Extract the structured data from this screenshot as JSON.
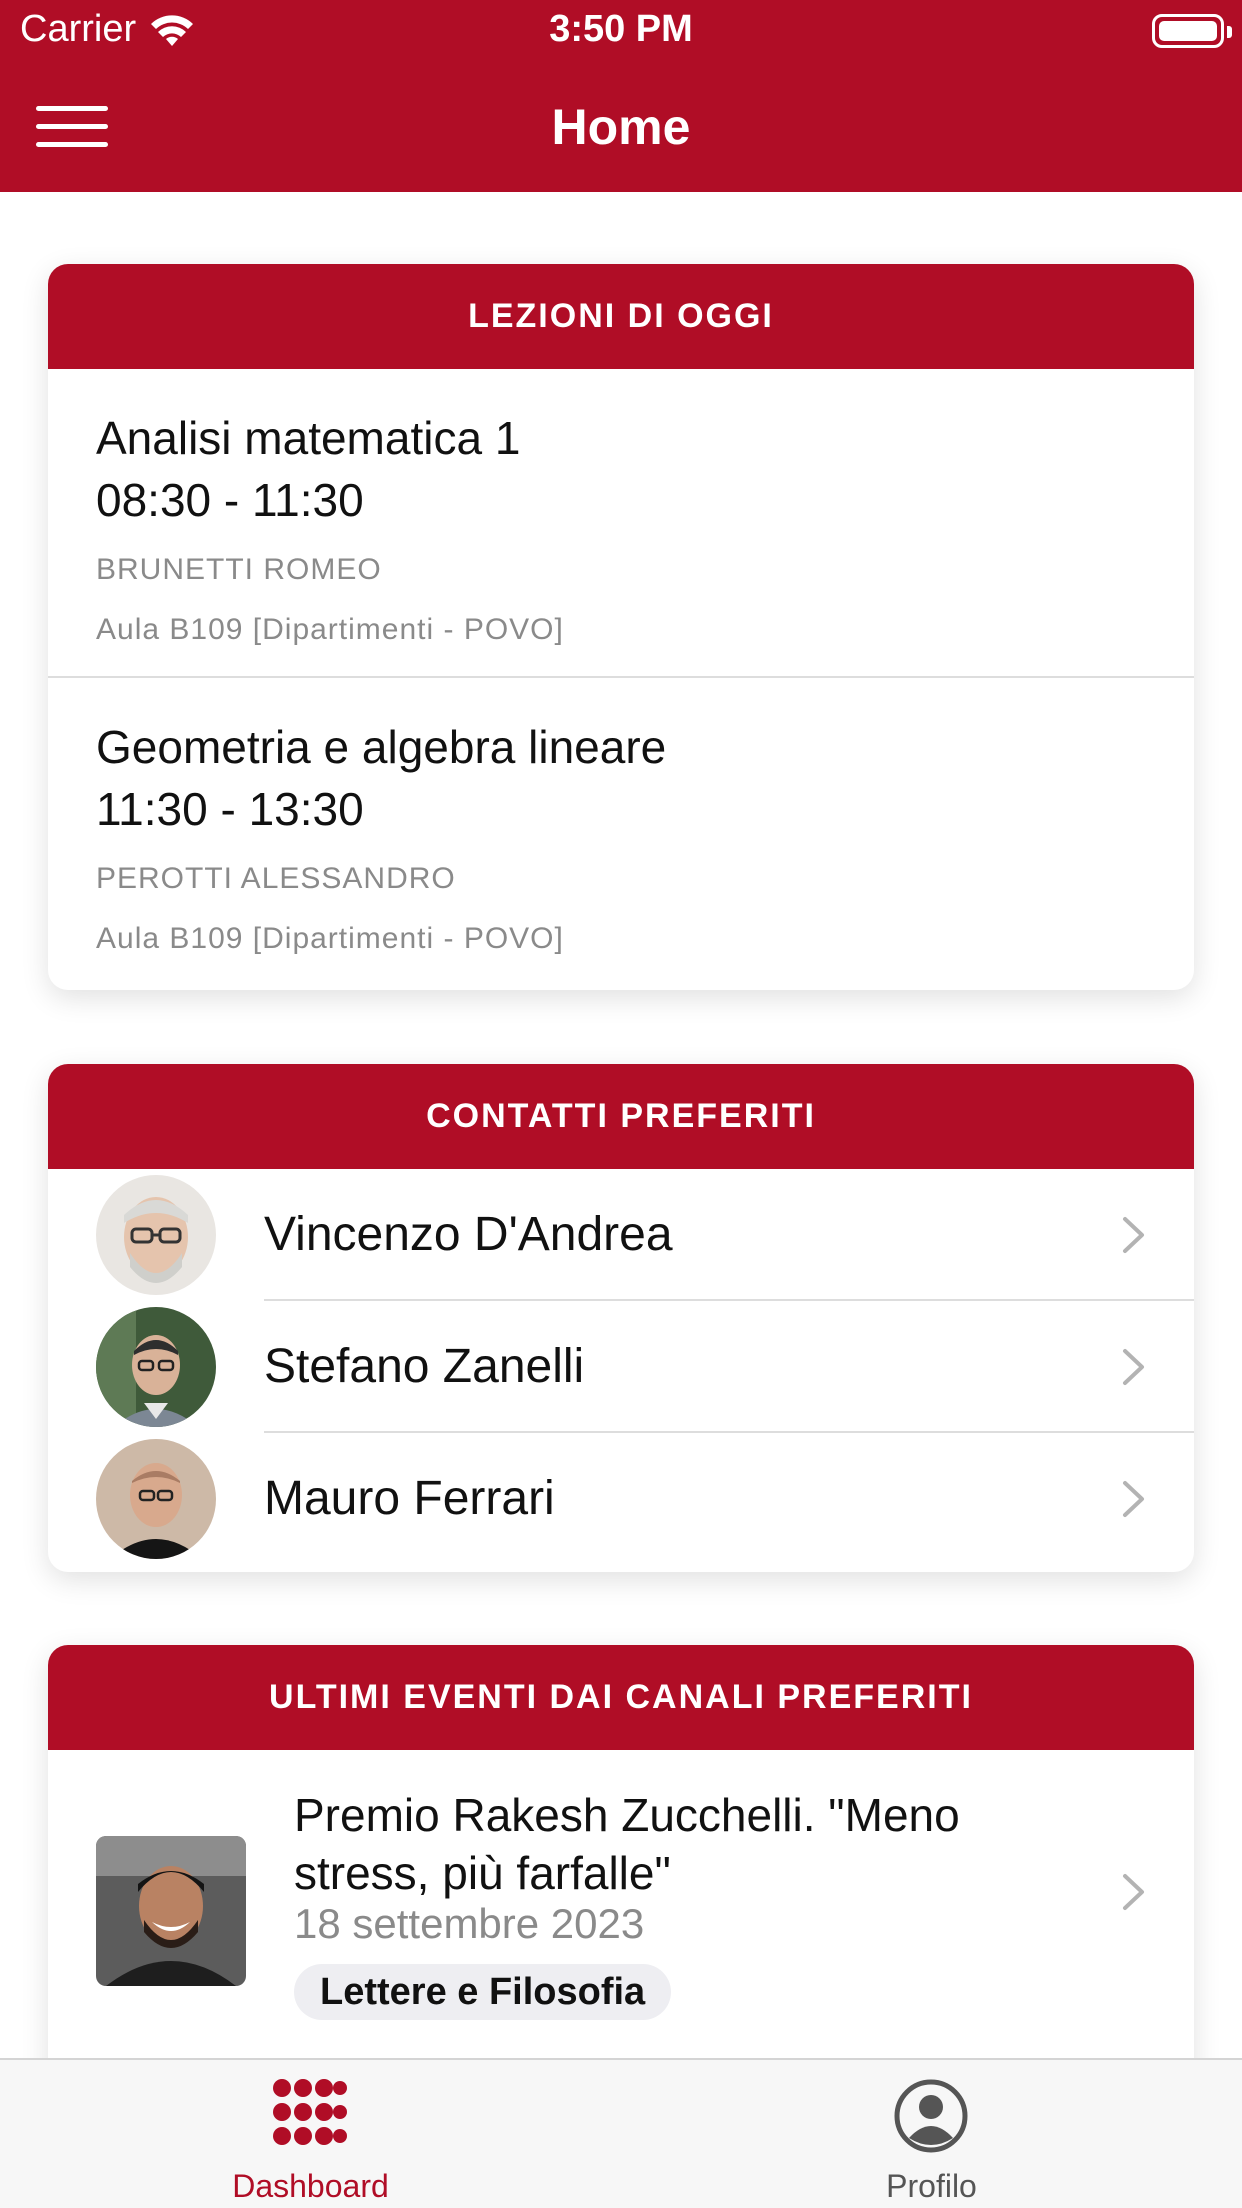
{
  "status_bar": {
    "carrier": "Carrier",
    "time": "3:50 PM"
  },
  "nav": {
    "title": "Home",
    "menu_icon": "hamburger-menu-icon"
  },
  "colors": {
    "brand": "#b00d26",
    "secondary_text": "#8a8a8a",
    "tab_inactive": "#555555"
  },
  "lessons_card": {
    "header": "LEZIONI DI OGGI",
    "items": [
      {
        "name": "Analisi matematica 1",
        "time": "08:30 - 11:30",
        "teacher": "BRUNETTI ROMEO",
        "room": "Aula B109 [Dipartimenti - POVO]"
      },
      {
        "name": "Geometria e algebra lineare",
        "time": "11:30 - 13:30",
        "teacher": "PEROTTI ALESSANDRO",
        "room": "Aula B109 [Dipartimenti - POVO]"
      }
    ]
  },
  "contacts_card": {
    "header": "CONTATTI PREFERITI",
    "items": [
      {
        "name": "Vincenzo D'Andrea",
        "icon": "chevron-right-icon"
      },
      {
        "name": "Stefano Zanelli",
        "icon": "chevron-right-icon"
      },
      {
        "name": "Mauro Ferrari",
        "icon": "chevron-right-icon"
      }
    ]
  },
  "events_card": {
    "header": "ULTIMI EVENTI DAI CANALI PREFERITI",
    "items": [
      {
        "title": "Premio Rakesh Zucchelli. \"Meno stress, più farfalle\"",
        "date": "18 settembre 2023",
        "channel": "Lettere e Filosofia",
        "icon": "chevron-right-icon"
      }
    ]
  },
  "tab_bar": {
    "tabs": [
      {
        "label": "Dashboard",
        "icon": "grid-dots-icon",
        "active": true
      },
      {
        "label": "Profilo",
        "icon": "profile-icon",
        "active": false
      }
    ]
  }
}
